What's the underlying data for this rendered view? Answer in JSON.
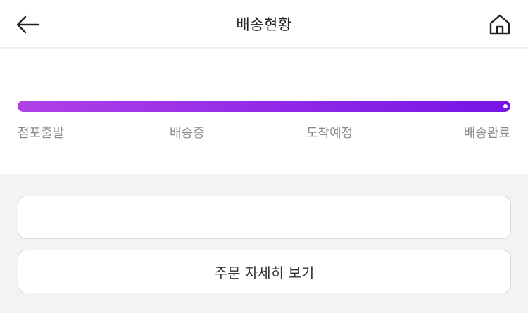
{
  "header": {
    "title": "배송현황"
  },
  "icons": {
    "back": "arrow-left-icon",
    "home": "home-icon"
  },
  "progress": {
    "value": 1.0,
    "gradient_start": "#b041e8",
    "gradient_end": "#7514e6",
    "steps": [
      {
        "label": "점포출발"
      },
      {
        "label": "배송중"
      },
      {
        "label": "도착예정"
      },
      {
        "label": "배송완료"
      }
    ]
  },
  "actions": {
    "order_detail_label": "주문 자세히 보기"
  }
}
